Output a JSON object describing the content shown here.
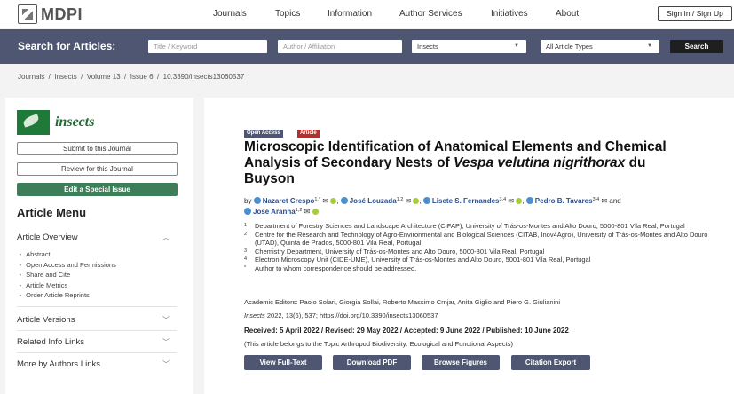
{
  "topnav": {
    "logo_text": "MDPI",
    "links": [
      "Journals",
      "Topics",
      "Information",
      "Author Services",
      "Initiatives",
      "About"
    ],
    "sign_in": "Sign In / Sign Up"
  },
  "search": {
    "label": "Search for Articles:",
    "title_placeholder": "Title / Keyword",
    "author_placeholder": "Author / Affiliation",
    "journal_value": "Insects",
    "type_value": "All Article Types",
    "button": "Search"
  },
  "breadcrumb": "Journals  /  Insects  /  Volume 13  /  Issue 6  /  10.3390/insects13060537",
  "sidebar": {
    "journal_name": "insects",
    "submit": "Submit to this Journal",
    "review": "Review for this Journal",
    "edit_issue": "Edit a Special Issue",
    "menu_title": "Article Menu",
    "overview": "Article Overview",
    "sub_items": [
      "Abstract",
      "Open Access and Permissions",
      "Share and Cite",
      "Article Metrics",
      "Order Article Reprints"
    ],
    "versions": "Article Versions",
    "related": "Related Info Links",
    "more_by": "More by Authors Links"
  },
  "article": {
    "badge_open": "Open Access",
    "badge_type": "Article",
    "title_part1": "Microscopic Identification of Anatomical Elements and Chemical Analysis of Secondary Nests of ",
    "title_species": "Vespa velutina nigrithorax",
    "title_part2": " du Buyson",
    "by": "by",
    "authors": [
      {
        "name": "Nazaret Crespo",
        "sup": "1,*"
      },
      {
        "name": "José Louzada",
        "sup": "1,2"
      },
      {
        "name": "Lisete S. Fernandes",
        "sup": "3,4"
      },
      {
        "name": "Pedro B. Tavares",
        "sup": "3,4"
      },
      {
        "name": "José Aranha",
        "sup": "1,2"
      }
    ],
    "and": "and",
    "affiliations": [
      {
        "num": "1",
        "text": "Department of Forestry Sciences and Landscape Architecture (CIFAP), University of Trás-os-Montes and Alto Douro, 5000-801 Vila Real, Portugal"
      },
      {
        "num": "2",
        "text": "Centre for the Research and Technology of Agro-Environmental and Biological Sciences (CITAB, Inov4Agro), University of Trás-os-Montes and Alto Douro (UTAD), Quinta de Prados, 5000-801 Vila Real, Portugal"
      },
      {
        "num": "3",
        "text": "Chemistry Department, University of Trás-os-Montes and Alto Douro, 5000-801 Vila Real, Portugal"
      },
      {
        "num": "4",
        "text": "Electron Microscopy Unit (CIDE-UME), University of Trás-os-Montes and Alto Douro, 5001-801 Vila Real, Portugal"
      },
      {
        "num": "*",
        "text": "Author to whom correspondence should be addressed."
      }
    ],
    "editors": "Academic Editors: Paolo Solari, Giorgia Sollai, Roberto Massimo Crnjar, Anita Giglio and Piero G. Giulianini",
    "citation_journal": "Insects",
    "citation_rest": " 2022, 13(6), 537; https://doi.org/10.3390/insects13060537",
    "dates": "Received: 5 April 2022 / Revised: 29 May 2022 / Accepted: 9 June 2022 / Published: 10 June 2022",
    "topic": "(This article belongs to the Topic Arthropod Biodiversity: Ecological and Functional Aspects)",
    "buttons": [
      "View Full-Text",
      "Download PDF",
      "Browse Figures",
      "Citation Export"
    ]
  },
  "colors": {
    "search_bar": "#4f5671",
    "journal_green": "#1f6e34",
    "badge_open": "#4f5671",
    "badge_article": "#b0302f",
    "author_link": "#2d4e8c"
  }
}
